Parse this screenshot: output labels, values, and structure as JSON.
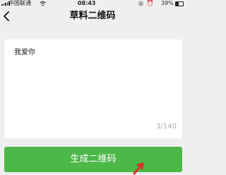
{
  "status_bar": {
    "carrier": "中国联通",
    "time": "08:43",
    "icons": "◎ ⏰",
    "battery_percent": "39%",
    "battery_level": 0.39
  },
  "nav": {
    "title": "草料二维码",
    "back_icon": "chevron-left-icon"
  },
  "input": {
    "value": "我爱你",
    "char_count": "3/140"
  },
  "button": {
    "label": "生成二维码"
  },
  "colors": {
    "accent": "#4cb848",
    "background": "#efefef",
    "card": "#ffffff",
    "pointer": "#d8332a"
  }
}
